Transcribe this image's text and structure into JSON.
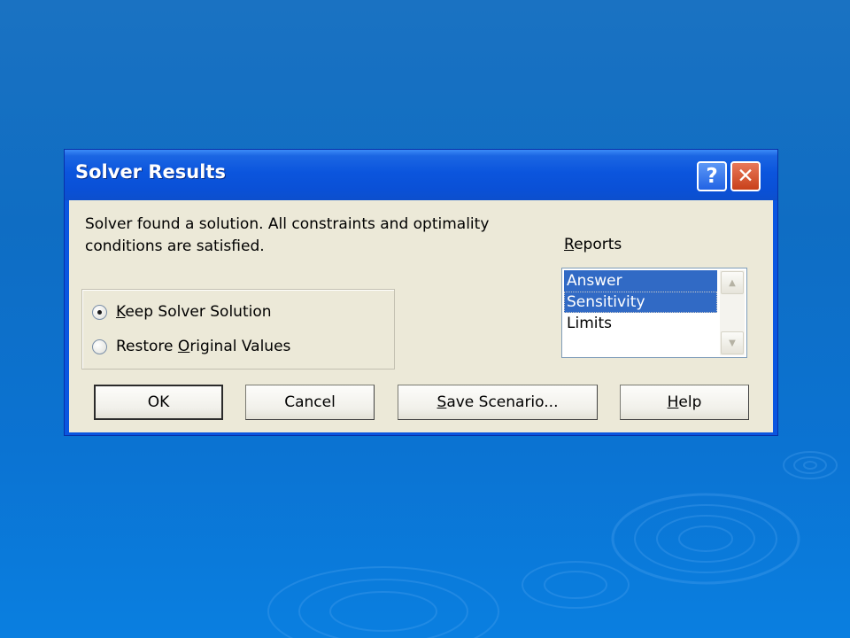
{
  "dialog": {
    "title": "Solver Results",
    "help_glyph": "?",
    "close_glyph": "✕"
  },
  "message": {
    "line1": "Solver found a solution.  All constraints and optimality",
    "line2": "conditions are satisfied."
  },
  "options": {
    "keep": {
      "prefix": "",
      "mnemonic": "K",
      "rest": "eep Solver Solution",
      "selected": true
    },
    "restore": {
      "prefix": "Restore ",
      "mnemonic": "O",
      "rest": "riginal Values",
      "selected": false
    }
  },
  "reports": {
    "label_mnemonic": "R",
    "label_rest": "eports",
    "items": [
      {
        "label": "Answer",
        "selected": true
      },
      {
        "label": "Sensitivity",
        "selected": true
      },
      {
        "label": "Limits",
        "selected": false
      }
    ]
  },
  "buttons": {
    "ok": "OK",
    "cancel": "Cancel",
    "scenario_mnemonic": "S",
    "scenario_rest": "ave Scenario...",
    "help_mnemonic": "H",
    "help_rest": "elp"
  },
  "colors": {
    "selection": "#316ac5",
    "titlebar": "#0a50d6",
    "dialog_bg": "#ece9d8"
  }
}
